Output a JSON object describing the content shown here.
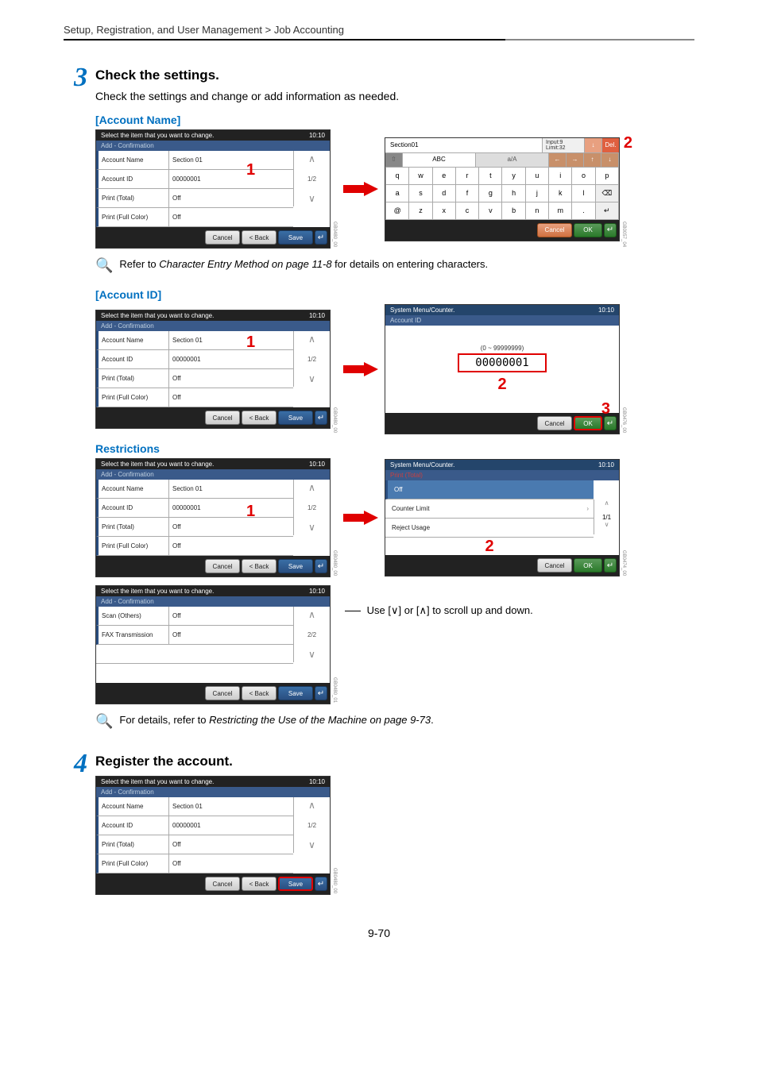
{
  "breadcrumb": "Setup, Registration, and User Management > Job Accounting",
  "step3": {
    "num": "3",
    "title": "Check the settings.",
    "text": "Check the settings and change or add information as needed."
  },
  "account_name_label": "[Account Name]",
  "account_id_label": "[Account ID]",
  "restrictions_label": "Restrictions",
  "panel_common": {
    "hdr": "Select the item that you want to change.",
    "time": "10:10",
    "sub": "Add - Confirmation",
    "items": [
      {
        "lbl": "Account Name",
        "val": "Section 01"
      },
      {
        "lbl": "Account ID",
        "val": "00000001"
      },
      {
        "lbl": "Print (Total)",
        "val": "Off"
      },
      {
        "lbl": "Print (Full Color)",
        "val": "Off"
      }
    ],
    "page": "1/2",
    "cancel": "Cancel",
    "back": "< Back",
    "save": "Save"
  },
  "panel_page2": {
    "items": [
      {
        "lbl": "Scan (Others)",
        "val": "Off"
      },
      {
        "lbl": "FAX Transmission",
        "val": "Off"
      }
    ],
    "page": "2/2"
  },
  "sidecodes": {
    "acct_name_left": "GB0480_00",
    "acct_name_right": "GB0057_04",
    "acct_id_left": "GB0480_00",
    "acct_id_right": "GB0476_00",
    "restrict_left1": "GB0480_00",
    "restrict_right": "GB0474_00",
    "restrict_left2": "GB0480_01",
    "register_left": "GB0480_00"
  },
  "kbd": {
    "input": "Section01",
    "limit1": "Input:9",
    "limit2": "Limit:32",
    "del": "Del.",
    "tab_blank": "",
    "tab_abc": "ABC",
    "tab_aA": "a/A",
    "row1": [
      "q",
      "w",
      "e",
      "r",
      "t",
      "y",
      "u",
      "i",
      "o",
      "p"
    ],
    "row2": [
      "a",
      "s",
      "d",
      "f",
      "g",
      "h",
      "j",
      "k",
      "l",
      "⌫"
    ],
    "row3": [
      "@",
      "z",
      "x",
      "c",
      "v",
      "b",
      "n",
      "m",
      ".",
      "↵"
    ],
    "cancel": "Cancel",
    "ok": "OK"
  },
  "num_panel": {
    "hdr": "System Menu/Counter.",
    "sub": "Account ID",
    "range": "(0 ~ 99999999)",
    "value": "00000001",
    "cancel": "Cancel",
    "ok": "OK"
  },
  "restrict_right": {
    "hdr": "System Menu/Counter.",
    "sub": "Print (Total)",
    "items": [
      "Off",
      "Counter Limit",
      "Reject Usage"
    ],
    "page": "1/1",
    "cancel": "Cancel",
    "ok": "OK"
  },
  "note1_pre": "Refer to ",
  "note1_em": "Character Entry Method on page 11-8",
  "note1_post": " for details on entering characters.",
  "scroll_note_pre": "Use [",
  "scroll_note_mid": "] or [",
  "scroll_note_post": "] to scroll up and down.",
  "note2_pre": "For details, refer to ",
  "note2_em": "Restricting the Use of the Machine on page 9-73",
  "note2_post": ".",
  "step4": {
    "num": "4",
    "title": "Register the account."
  },
  "page_num": "9-70",
  "callouts": {
    "c1": "1",
    "c2": "2",
    "c3": "3"
  }
}
